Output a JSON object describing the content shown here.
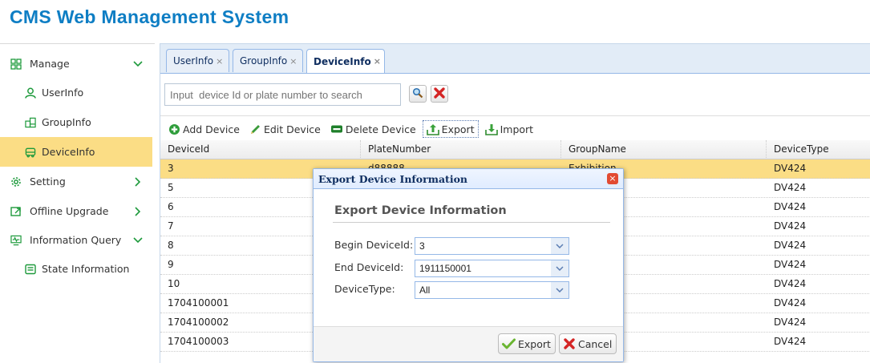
{
  "app": {
    "title": "CMS Web Management System"
  },
  "sidebar": {
    "items": [
      {
        "label": "Manage",
        "icon": "grid-icon",
        "expanded": true
      },
      {
        "label": "UserInfo",
        "icon": "user-icon"
      },
      {
        "label": "GroupInfo",
        "icon": "group-icon"
      },
      {
        "label": "DeviceInfo",
        "icon": "bus-icon",
        "active": true
      },
      {
        "label": "Setting",
        "icon": "gear-icon",
        "expanded": false
      },
      {
        "label": "Offline Upgrade",
        "icon": "upgrade-icon",
        "expanded": false
      },
      {
        "label": "Information Query",
        "icon": "monitor-icon",
        "expanded": true
      },
      {
        "label": "State Information",
        "icon": "document-icon"
      }
    ]
  },
  "tabs": [
    {
      "label": "UserInfo",
      "close": "×"
    },
    {
      "label": "GroupInfo",
      "close": "×"
    },
    {
      "label": "DeviceInfo",
      "close": "×",
      "selected": true
    }
  ],
  "search": {
    "placeholder": "Input  device Id or plate number to search"
  },
  "toolbar": {
    "add": "Add Device",
    "edit": "Edit Device",
    "delete": "Delete Device",
    "export": "Export",
    "import": "Import"
  },
  "table": {
    "columns": [
      "DeviceId",
      "PlateNumber",
      "GroupName",
      "DeviceType"
    ],
    "rows": [
      [
        "3",
        "d88888",
        "Exhibition",
        "DV424"
      ],
      [
        "5",
        "",
        "",
        "DV424"
      ],
      [
        "6",
        "",
        "",
        "DV424"
      ],
      [
        "7",
        "",
        "",
        "DV424"
      ],
      [
        "8",
        "",
        "",
        "DV424"
      ],
      [
        "9",
        "",
        "",
        "DV424"
      ],
      [
        "10",
        "",
        "",
        "DV424"
      ],
      [
        "1704100001",
        "",
        "",
        "DV424"
      ],
      [
        "1704100002",
        "",
        "",
        "DV424"
      ],
      [
        "1704100003",
        "",
        "",
        "DV424"
      ]
    ],
    "selected_row": 0
  },
  "dialog": {
    "title": "Export Device Information",
    "close": "×",
    "heading": "Export Device Information",
    "fields": [
      {
        "label": "Begin DeviceId:",
        "value": "3"
      },
      {
        "label": "End DeviceId:",
        "value": "1911150001"
      },
      {
        "label": "DeviceType:",
        "value": "All"
      }
    ],
    "export_label": "Export",
    "cancel_label": "Cancel"
  },
  "colors": {
    "title_blue": "#0e7ec4",
    "selection_yellow": "#fbdd85",
    "border_blue": "#95b8e7"
  }
}
